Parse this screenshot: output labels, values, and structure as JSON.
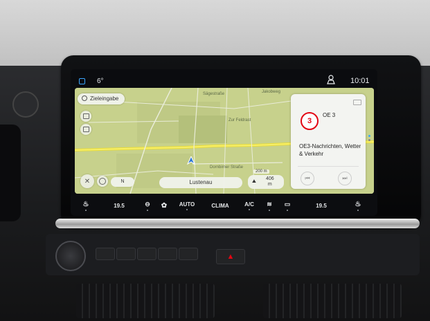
{
  "status_bar": {
    "temperature": "6°",
    "time": "10:01"
  },
  "map": {
    "search_label": "Zieleingabe",
    "street_labels": [
      "Sägestraße",
      "Jakobweg",
      "Zur Feldrast",
      "Dornbirner Straße"
    ],
    "scale": "200 m",
    "orientation": "N",
    "location": "Lustenau",
    "speed_limit": "406\nm"
  },
  "media": {
    "station": "OE 3",
    "station_logo": "3",
    "description": "OE3-Nachrichten, Wetter & Verkehr"
  },
  "climate_bar": {
    "left_temp": "19.5",
    "auto_label": "AUTO",
    "clima_label": "CLIMA",
    "ac_label": "A/C",
    "right_temp": "19.5"
  },
  "colors": {
    "map_bg": "#c9d28f",
    "road": "#f1e84a",
    "accent": "#e30613"
  }
}
